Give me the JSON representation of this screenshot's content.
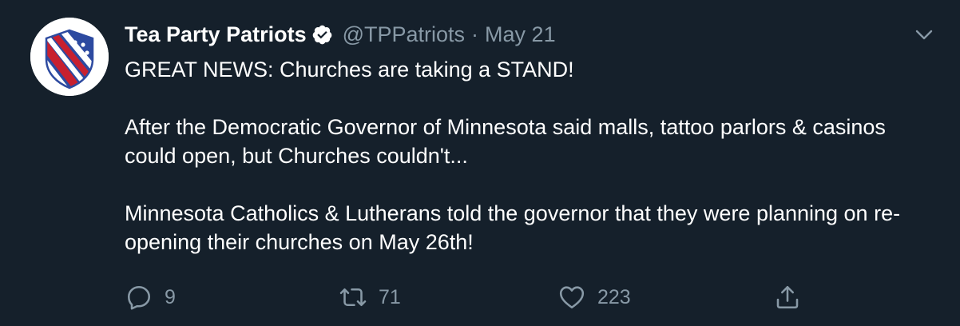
{
  "tweet": {
    "author_name": "Tea Party Patriots",
    "handle": "@TPPatriots",
    "separator": "·",
    "date": "May 21",
    "paragraphs": [
      "GREAT NEWS: Churches are taking a STAND!",
      "After the Democratic Governor of Minnesota said malls, tattoo parlors & casinos could open, but Churches couldn't...",
      "Minnesota Catholics & Lutherans told the governor that they were planning on re-opening their churches on May 26th!"
    ],
    "actions": {
      "replies": "9",
      "retweets": "71",
      "likes": "223"
    }
  },
  "icons": {
    "avatar": "tea-party-patriots-shield-logo",
    "verified": "verified-badge-icon",
    "menu": "chevron-down-icon",
    "reply": "reply-icon",
    "retweet": "retweet-icon",
    "like": "heart-icon",
    "share": "share-icon"
  },
  "colors": {
    "background": "#15202b",
    "text": "#ffffff",
    "secondary_text": "#8899a6"
  }
}
